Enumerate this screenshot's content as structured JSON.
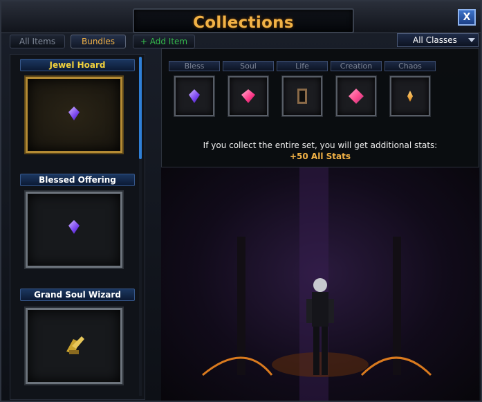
{
  "title": "Collections",
  "close_label": "X",
  "tabs": {
    "all_items": "All Items",
    "bundles": "Bundles",
    "add_item": "+ Add Item"
  },
  "class_filter": {
    "selected": "All Classes"
  },
  "bundles": [
    {
      "name": "Jewel Hoard",
      "active": true,
      "label_color": "#f2d23c"
    },
    {
      "name": "Blessed Offering",
      "active": false,
      "label_color": "#ffffff"
    },
    {
      "name": "Grand Soul Wizard",
      "active": false,
      "label_color": "#ffffff"
    }
  ],
  "set_items": [
    {
      "label": "Bless",
      "icon": "bless-jewel-icon",
      "color": "#9b6cff"
    },
    {
      "label": "Soul",
      "icon": "soul-jewel-icon",
      "color": "#ff4f9a"
    },
    {
      "label": "Life",
      "icon": "life-jewel-icon",
      "color": "#b08a5a"
    },
    {
      "label": "Creation",
      "icon": "creation-jewel-icon",
      "color": "#ff6fb0"
    },
    {
      "label": "Chaos",
      "icon": "chaos-jewel-icon",
      "color": "#f2a73a"
    }
  ],
  "set_bonus": {
    "description": "If you collect the entire set, you will get additional stats:",
    "value": "+50 All Stats"
  }
}
